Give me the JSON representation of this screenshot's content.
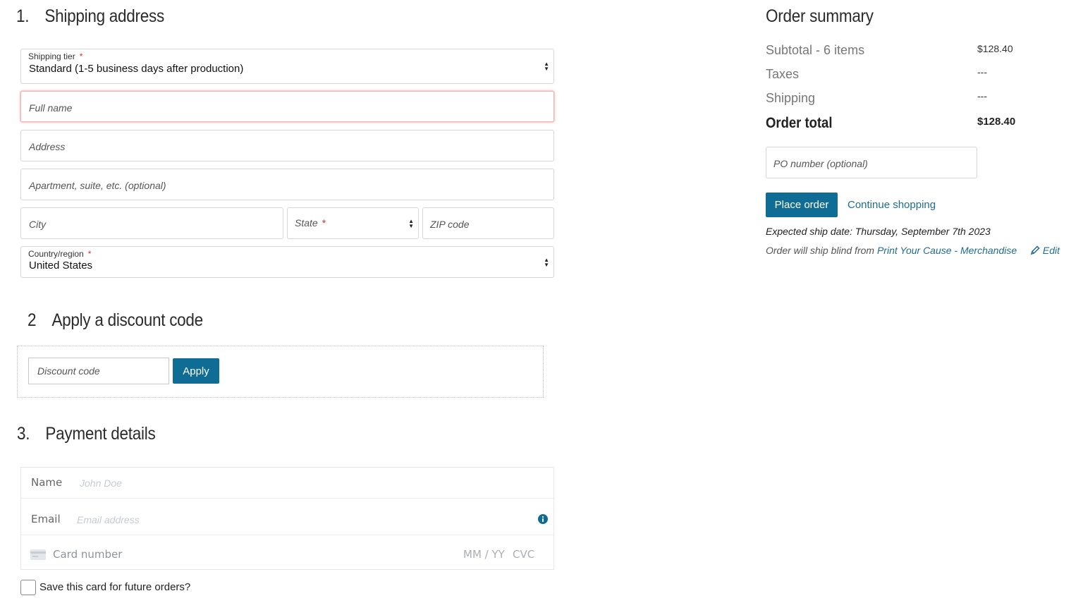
{
  "shipping": {
    "heading_num": "1.",
    "heading": "Shipping address",
    "tier_label": "Shipping tier",
    "tier_value": "Standard (1-5 business days after production)",
    "full_name_placeholder": "Full name",
    "address_placeholder": "Address",
    "apartment_placeholder": "Apartment, suite, etc. (optional)",
    "city_placeholder": "City",
    "state_placeholder": "State",
    "zip_placeholder": "ZIP code",
    "country_label": "Country/region",
    "country_value": "United States",
    "required_mark": "*"
  },
  "discount": {
    "heading_num": "2",
    "heading": "Apply a discount code",
    "placeholder": "Discount code",
    "apply_label": "Apply"
  },
  "payment": {
    "heading_num": "3.",
    "heading": "Payment details",
    "name_label": "Name",
    "name_placeholder": "John Doe",
    "email_label": "Email",
    "email_placeholder": "Email address",
    "card_placeholder": "Card number",
    "expiry_placeholder": "MM / YY",
    "cvc_placeholder": "CVC",
    "save_card_label": "Save this card for future orders?"
  },
  "summary": {
    "heading": "Order summary",
    "subtotal_label": "Subtotal - 6 items",
    "subtotal_value": "$128.40",
    "taxes_label": "Taxes",
    "taxes_value": "---",
    "shipping_label": "Shipping",
    "shipping_value": "---",
    "total_label": "Order total",
    "total_value": "$128.40",
    "po_placeholder": "PO number (optional)",
    "place_order_label": "Place order",
    "continue_label": "Continue shopping",
    "expected_ship": "Expected ship date: Thursday, September 7th 2023",
    "ship_blind_prefix": "Order will ship blind from",
    "ship_blind_store": "Print Your Cause - Merchandise",
    "edit_label": "Edit"
  },
  "colors": {
    "primary": "#0f6c94",
    "link": "#1f6d8c",
    "required": "#d9302c",
    "error_border": "#f2b5b5"
  }
}
